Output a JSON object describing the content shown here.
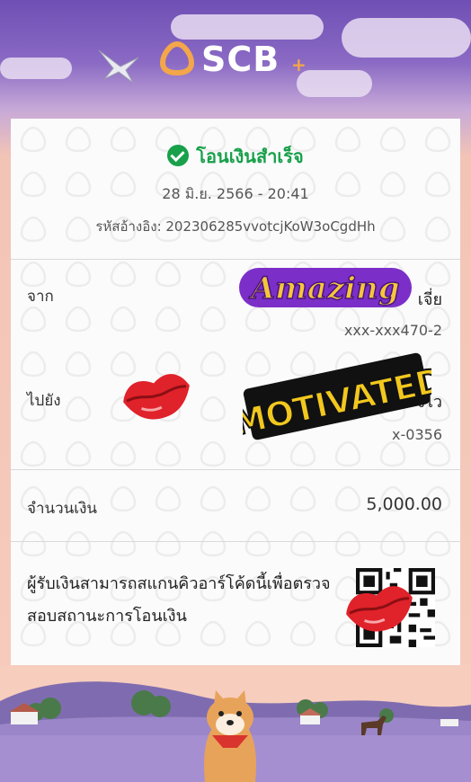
{
  "brand": {
    "name": "SCB",
    "plus": "+"
  },
  "receipt": {
    "status": "โอนเงินสำเร็จ",
    "datetime": "28 มิ.ย. 2566 - 20:41",
    "reference": "รหัสอ้างอิง: 202306285vvotcjKoW3oCgdHh",
    "from": {
      "label": "จาก",
      "name_fragment": "เจี่ย",
      "account": "xxx-xxx470-2"
    },
    "to": {
      "label": "ไปยัง",
      "name_fragment": "งไว",
      "account": "x-0356"
    },
    "amount": {
      "label": "จำนวนเงิน",
      "value": "5,000.00"
    },
    "qr_note": "ผู้รับเงินสามารถสแกนคิวอาร์โค้ดนี้เพื่อตรวจสอบสถานะการโอนเงิน"
  },
  "stickers": {
    "amazing": "Amazing",
    "motivated": "MOTIVATED"
  },
  "colors": {
    "success": "#18a04a",
    "amazing_yellow": "#f6c63a",
    "amazing_purple": "#7b2fc8",
    "motivated_yellow": "#f2c81e",
    "lips_red": "#e0222a"
  }
}
